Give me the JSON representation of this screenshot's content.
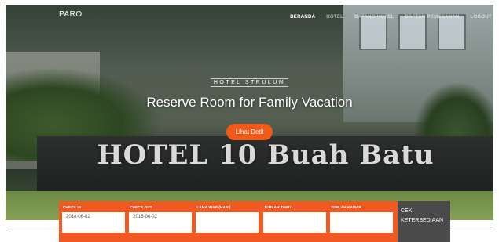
{
  "header": {
    "brand": "PARO",
    "nav": [
      {
        "label": "BERANDA",
        "active": true
      },
      {
        "label": "HOTEL",
        "active": false
      },
      {
        "label": "DATANG HOTEL",
        "active": false
      },
      {
        "label": "DAFTAR PEMESANAN",
        "active": false
      },
      {
        "label": "LOGOUT",
        "active": false
      }
    ]
  },
  "hero": {
    "subtitle": "HOTEL STRULUM",
    "headline": "Reserve Room for Family Vacation",
    "cta_label": "Lihat Detil",
    "sign_text": "HOTEL 10 Buah Batu"
  },
  "booking": {
    "fields": [
      {
        "label": "CHECK IN",
        "value": "2018-06-02"
      },
      {
        "label": "CHECK OUT",
        "value": "2018-06-02"
      },
      {
        "label": "LAMA INAP (HARI)",
        "value": ""
      },
      {
        "label": "JUMLAH TAMU",
        "value": ""
      },
      {
        "label": "JUMLAH KAMAR",
        "value": ""
      }
    ],
    "check_button": "CEK KETERSEDIAAN"
  },
  "colors": {
    "accent": "#f05a22",
    "button_dark": "#4a4a4a"
  }
}
